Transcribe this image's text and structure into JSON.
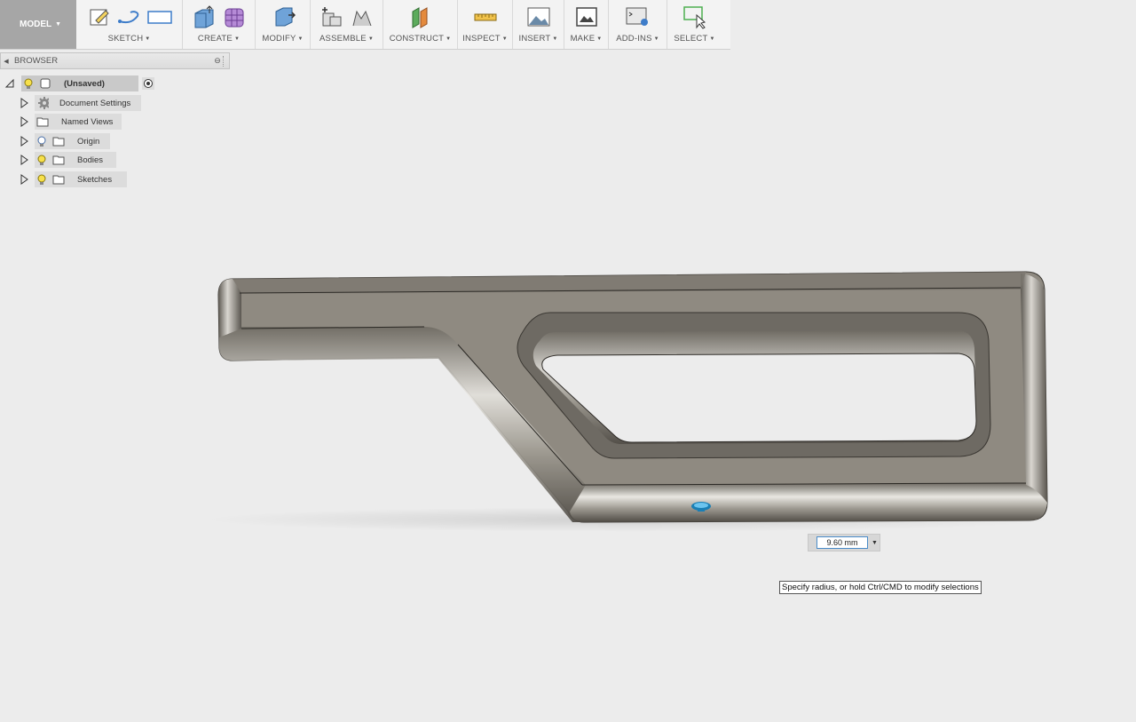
{
  "toolbar": {
    "workspace": "MODEL",
    "groups": [
      {
        "label": "SKETCH"
      },
      {
        "label": "CREATE"
      },
      {
        "label": "MODIFY"
      },
      {
        "label": "ASSEMBLE"
      },
      {
        "label": "CONSTRUCT"
      },
      {
        "label": "INSPECT"
      },
      {
        "label": "INSERT"
      },
      {
        "label": "MAKE"
      },
      {
        "label": "ADD-INS"
      },
      {
        "label": "SELECT"
      }
    ]
  },
  "browser": {
    "title": "BROWSER",
    "root": "(Unsaved)",
    "items": [
      {
        "label": "Document Settings"
      },
      {
        "label": "Named Views"
      },
      {
        "label": "Origin"
      },
      {
        "label": "Bodies"
      },
      {
        "label": "Sketches"
      }
    ]
  },
  "dimension": {
    "value": "9.60 mm"
  },
  "tooltip": "Specify radius, or hold Ctrl/CMD to modify selections",
  "colors": {
    "accent": "#4a8cc9",
    "part_face": "#8c877e",
    "manipulator": "#1a7fb5"
  }
}
